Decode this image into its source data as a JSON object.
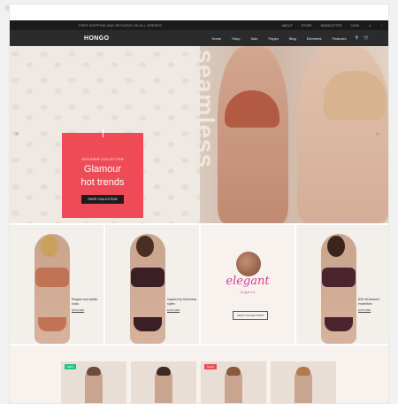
{
  "topbar": {
    "promo": "FREE SHIPPING AND RETURNS ON ALL ORDERS",
    "links": [
      "ABOUT",
      "STORE",
      "NEWSLETTER",
      "CASH"
    ]
  },
  "nav": {
    "logo": "HONGO",
    "items": [
      "Home",
      "Shop",
      "Sale",
      "Pages",
      "Blog",
      "Elements",
      "Features"
    ]
  },
  "hero": {
    "promo_small": "DESIGNER COLLECTION",
    "promo_big_1": "Glamour",
    "promo_big_2": "hot trends",
    "promo_button": "SHOP COLLECTION",
    "vertical_word": "seamless",
    "arrow_left": "«",
    "arrow_right": "»"
  },
  "grid": {
    "tile1_cap": "Elegant and stylish looks",
    "tile2_cap": "Inspired by freshness styles",
    "tile4_cap": "$25 off bestsell essentials",
    "explore": "EXPLORE",
    "elegant_word": "elegant",
    "elegant_sub": "lingerie",
    "elegant_btn": "SHOP COLLECTIONS"
  },
  "products": {
    "badge_new": "NEW",
    "badge_sale": "SALE"
  },
  "colors": {
    "accent": "#ee4b57",
    "brand_pink": "#d63b8f",
    "badge_new": "#27c18a",
    "badge_sale": "#ee4b57"
  }
}
